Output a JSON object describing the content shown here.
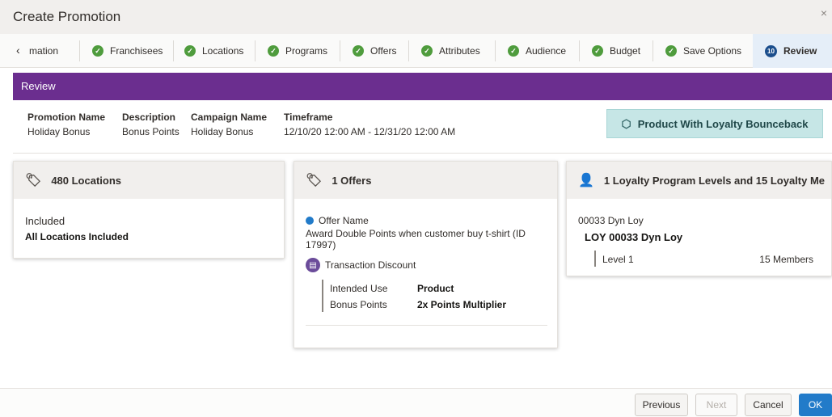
{
  "dialog": {
    "title": "Create Promotion",
    "close_glyph": "×"
  },
  "train": {
    "prev_glyph": "‹",
    "steps": [
      {
        "label": "mation"
      },
      {
        "label": "Franchisees"
      },
      {
        "label": "Locations"
      },
      {
        "label": "Programs"
      },
      {
        "label": "Offers"
      },
      {
        "label": "Attributes"
      },
      {
        "label": "Audience"
      },
      {
        "label": "Budget"
      },
      {
        "label": "Save Options"
      },
      {
        "label": "Review",
        "number": "10"
      }
    ]
  },
  "review_header": "Review",
  "summary": {
    "promotion_name": {
      "label": "Promotion Name",
      "value": "Holiday Bonus"
    },
    "description": {
      "label": "Description",
      "value": "Bonus Points"
    },
    "campaign_name": {
      "label": "Campaign Name",
      "value": "Holiday Bonus"
    },
    "timeframe": {
      "label": "Timeframe",
      "value": "12/10/20 12:00 AM - 12/31/20 12:00 AM"
    },
    "promo_type": "Product With Loyalty Bounceback"
  },
  "locations_card": {
    "title": "480 Locations",
    "status": "Included",
    "detail": "All Locations Included"
  },
  "offers_card": {
    "title": "1 Offers",
    "offer_name_label": "Offer Name",
    "offer_description": "Award Double Points when customer buy t-shirt (ID 17997)",
    "offer_type": "Transaction Discount",
    "intended_use_label": "Intended Use",
    "intended_use_value": "Product",
    "bonus_points_label": "Bonus Points",
    "bonus_points_value": "2x Points Multiplier"
  },
  "loyalty_card": {
    "title": "1 Loyalty Program Levels and 15 Loyalty Me",
    "program_code": "00033 Dyn Loy",
    "program_name": "LOY 00033 Dyn Loy",
    "level_label": "Level 1",
    "members": "15 Members"
  },
  "footer": {
    "previous": "Previous",
    "next": "Next",
    "cancel": "Cancel",
    "ok": "OK"
  },
  "colors": {
    "review_bar": "#6b2e8f",
    "check": "#4f9c3d",
    "primary_button": "#227bc9",
    "badge": "#c6e6e6"
  }
}
